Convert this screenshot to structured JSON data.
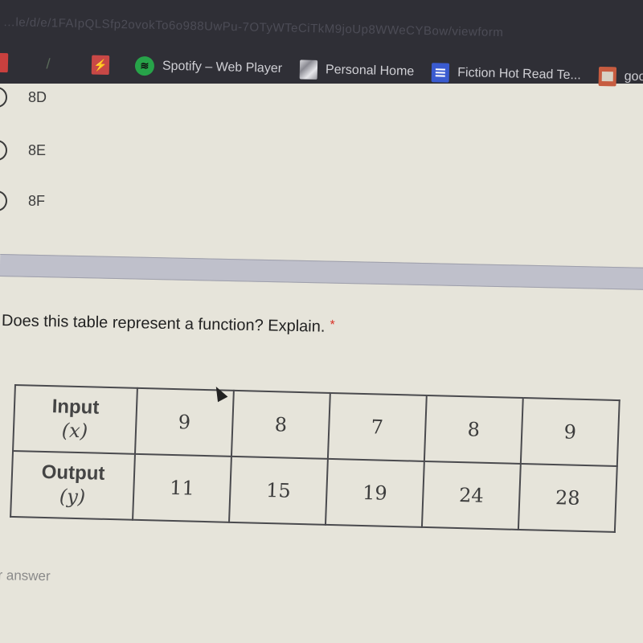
{
  "browser": {
    "url_text": "…le/d/e/1FAIpQLSfp2ovokTo6o988UwPu-7OTyWTeCiTkM9joUp8WWeCYBow/viewform",
    "bookmarks": [
      {
        "icon": "red-bookmark-icon",
        "label": ""
      },
      {
        "icon": "slash-bookmark-icon",
        "label": ""
      },
      {
        "icon": "lightning-bolt-icon",
        "label": ""
      },
      {
        "icon": "spotify-icon",
        "label": "Spotify – Web Player"
      },
      {
        "icon": "photo-thumbnail-icon",
        "label": "Personal Home"
      },
      {
        "icon": "google-docs-icon",
        "label": "Fiction Hot Read Te..."
      },
      {
        "icon": "google-slides-icon",
        "label": "google sl"
      }
    ]
  },
  "form": {
    "previous_question": {
      "options": [
        "8D",
        "8E",
        "8F"
      ]
    },
    "question": {
      "text": "Does this table represent a function? Explain.",
      "required_marker": "*",
      "answer_placeholder": "Your answer",
      "answer_visible_text": "ur answer"
    },
    "table": {
      "row_headers": [
        {
          "label": "Input",
          "var": "(x)"
        },
        {
          "label": "Output",
          "var": "(y)"
        }
      ],
      "inputs": [
        "9",
        "8",
        "7",
        "8",
        "9"
      ],
      "outputs": [
        "11",
        "15",
        "19",
        "24",
        "28"
      ]
    }
  }
}
